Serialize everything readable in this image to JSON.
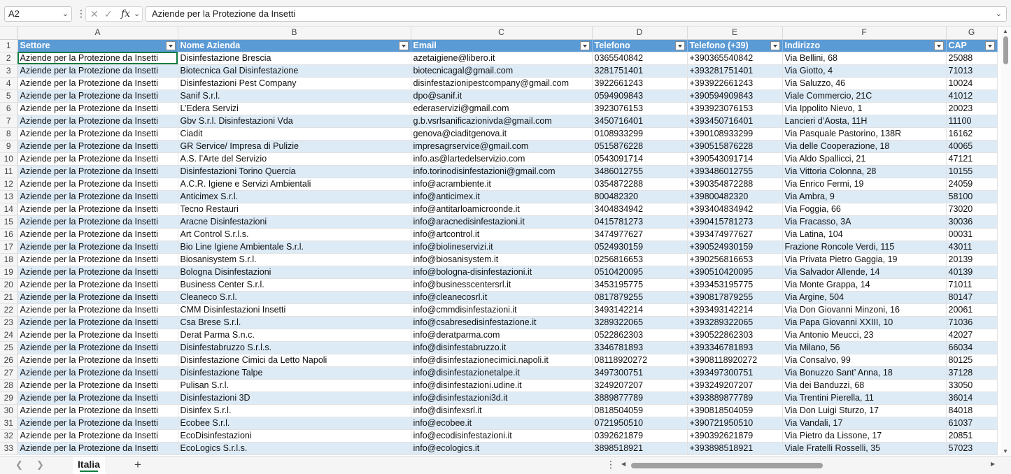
{
  "formula_bar": {
    "name_box": "A2",
    "fx_label": "fx",
    "value": "Aziende per la Protezione da Insetti"
  },
  "columns": [
    "A",
    "B",
    "C",
    "D",
    "E",
    "F",
    "G"
  ],
  "table_headers": [
    "Settore",
    "Nome Azienda",
    "Email",
    "Telefono",
    "Telefono (+39)",
    "Indirizzo",
    "CAP"
  ],
  "rows": [
    [
      "Aziende per la Protezione da Insetti",
      "Disinfestazione Brescia",
      "azetaigiene@libero.it",
      "0365540842",
      "+390365540842",
      "Via Bellini, 68",
      "25088"
    ],
    [
      "Aziende per la Protezione da Insetti",
      "Biotecnica Gal Disinfestazione",
      "biotecnicagal@gmail.com",
      "3281751401",
      "+393281751401",
      "Via Giotto, 4",
      "71013"
    ],
    [
      "Aziende per la Protezione da Insetti",
      "Disinfestazioni Pest Company",
      "disinfestazionipestcompany@gmail.com",
      "3922661243",
      "+393922661243",
      "Via Saluzzo, 46",
      "10024"
    ],
    [
      "Aziende per la Protezione da Insetti",
      "Sanif S.r.l.",
      "dpo@sanif.it",
      "0594909843",
      "+390594909843",
      "Viale Commercio, 21C",
      "41012"
    ],
    [
      "Aziende per la Protezione da Insetti",
      "L’Edera Servizi",
      "ederaservizi@gmail.com",
      "3923076153",
      "+393923076153",
      "Via Ippolito Nievo, 1",
      "20023"
    ],
    [
      "Aziende per la Protezione da Insetti",
      "Gbv S.r.l. Disinfestazioni Vda",
      "g.b.vsrlsanificazionivda@gmail.com",
      "3450716401",
      "+393450716401",
      "Lancieri d’Aosta, 11H",
      "11100"
    ],
    [
      "Aziende per la Protezione da Insetti",
      "Ciadit",
      "genova@ciaditgenova.it",
      "0108933299",
      "+390108933299",
      "Via Pasquale Pastorino, 138R",
      "16162"
    ],
    [
      "Aziende per la Protezione da Insetti",
      "GR Service/ Impresa di Pulizie",
      "impresagrservice@gmail.com",
      "0515876228",
      "+390515876228",
      "Via delle Cooperazione, 18",
      "40065"
    ],
    [
      "Aziende per la Protezione da Insetti",
      "A.S. l’Arte del Servizio",
      "info.as@lartedelservizio.com",
      "0543091714",
      "+390543091714",
      "Via Aldo Spallicci, 21",
      "47121"
    ],
    [
      "Aziende per la Protezione da Insetti",
      "Disinfestazioni Torino Quercia",
      "info.torinodisinfestazioni@gmail.com",
      "3486012755",
      "+393486012755",
      "Via Vittoria Colonna, 28",
      "10155"
    ],
    [
      "Aziende per la Protezione da Insetti",
      "A.C.R. Igiene e Servizi Ambientali",
      "info@acrambiente.it",
      "0354872288",
      "+390354872288",
      "Via Enrico Fermi, 19",
      "24059"
    ],
    [
      "Aziende per la Protezione da Insetti",
      "Anticimex S.r.l.",
      "info@anticimex.it",
      "800482320",
      "+39800482320",
      "Via Ambra, 9",
      "58100"
    ],
    [
      "Aziende per la Protezione da Insetti",
      "Tecno Restauri",
      "info@antitarloamicroonde.it",
      "3404834942",
      "+393404834942",
      "Via Foggia, 66",
      "73020"
    ],
    [
      "Aziende per la Protezione da Insetti",
      "Aracne Disinfestazioni",
      "info@aracnedisinfestazioni.it",
      "0415781273",
      "+390415781273",
      "Via Fracasso, 3A",
      "30036"
    ],
    [
      "Aziende per la Protezione da Insetti",
      "Art Control S.r.l.s.",
      "info@artcontrol.it",
      "3474977627",
      "+393474977627",
      "Via Latina, 104",
      "00031"
    ],
    [
      "Aziende per la Protezione da Insetti",
      "Bio Line Igiene Ambientale S.r.l.",
      "info@biolineservizi.it",
      "0524930159",
      "+390524930159",
      "Frazione Roncole Verdi, 115",
      "43011"
    ],
    [
      "Aziende per la Protezione da Insetti",
      "Biosanisystem S.r.l.",
      "info@biosanisystem.it",
      "0256816653",
      "+390256816653",
      "Via Privata Pietro Gaggia, 19",
      "20139"
    ],
    [
      "Aziende per la Protezione da Insetti",
      "Bologna Disinfestazioni",
      "info@bologna-disinfestazioni.it",
      "0510420095",
      "+390510420095",
      "Via Salvador Allende, 14",
      "40139"
    ],
    [
      "Aziende per la Protezione da Insetti",
      "Business Center S.r.l.",
      "info@businesscentersrl.it",
      "3453195775",
      "+393453195775",
      "Via Monte Grappa, 14",
      "71011"
    ],
    [
      "Aziende per la Protezione da Insetti",
      "Cleaneco S.r.l.",
      "info@cleanecosrl.it",
      "0817879255",
      "+390817879255",
      "Via Argine, 504",
      "80147"
    ],
    [
      "Aziende per la Protezione da Insetti",
      "CMM Disinfestazioni Insetti",
      "info@cmmdisinfestazioni.it",
      "3493142214",
      "+393493142214",
      "Via Don Giovanni Minzoni, 16",
      "20061"
    ],
    [
      "Aziende per la Protezione da Insetti",
      "Csa Brese S.r.l.",
      "info@csabresedisinfestazione.it",
      "3289322065",
      "+393289322065",
      "Via Papa Giovanni XXIII, 10",
      "71036"
    ],
    [
      "Aziende per la Protezione da Insetti",
      "Derat Parma S.n.c.",
      "info@deratparma.com",
      "0522862303",
      "+390522862303",
      "Via Antonio Meucci, 23",
      "42027"
    ],
    [
      "Aziende per la Protezione da Insetti",
      "Disinfestabruzzo S.r.l.s.",
      "info@disinfestabruzzo.it",
      "3346781893",
      "+393346781893",
      "Via Milano, 56",
      "66034"
    ],
    [
      "Aziende per la Protezione da Insetti",
      "Disinfestazione Cimici da Letto Napoli",
      "info@disinfestazionecimici.napoli.it",
      "08118920272",
      "+3908118920272",
      "Via Consalvo, 99",
      "80125"
    ],
    [
      "Aziende per la Protezione da Insetti",
      "Disinfestazione Talpe",
      "info@disinfestazionetalpe.it",
      "3497300751",
      "+393497300751",
      "Via Bonuzzo Sant’ Anna, 18",
      "37128"
    ],
    [
      "Aziende per la Protezione da Insetti",
      "Pulisan S.r.l.",
      "info@disinfestazioni.udine.it",
      "3249207207",
      "+393249207207",
      "Via dei Banduzzi, 68",
      "33050"
    ],
    [
      "Aziende per la Protezione da Insetti",
      "Disinfestazioni 3D",
      "info@disinfestazioni3d.it",
      "3889877789",
      "+393889877789",
      "Via Trentini Pierella, 11",
      "36014"
    ],
    [
      "Aziende per la Protezione da Insetti",
      "Disinfex S.r.l.",
      "info@disinfexsrl.it",
      "0818504059",
      "+390818504059",
      "Via Don Luigi Sturzo, 17",
      "84018"
    ],
    [
      "Aziende per la Protezione da Insetti",
      "Ecobee S.r.l.",
      "info@ecobee.it",
      "0721950510",
      "+390721950510",
      "Via Vandali, 17",
      "61037"
    ],
    [
      "Aziende per la Protezione da Insetti",
      "EcoDisinfestazioni",
      "info@ecodisinfestazioni.it",
      "0392621879",
      "+390392621879",
      "Via Pietro da Lissone, 17",
      "20851"
    ],
    [
      "Aziende per la Protezione da Insetti",
      "EcoLogics S.r.l.s.",
      "info@ecologics.it",
      "3898518921",
      "+393898518921",
      "Viale Fratelli Rosselli, 35",
      "57023"
    ]
  ],
  "sheet_tabs": [
    "Italia"
  ],
  "colors": {
    "header_blue": "#5b9bd5",
    "band_blue": "#ddebf7",
    "selection_green": "#107c41"
  }
}
